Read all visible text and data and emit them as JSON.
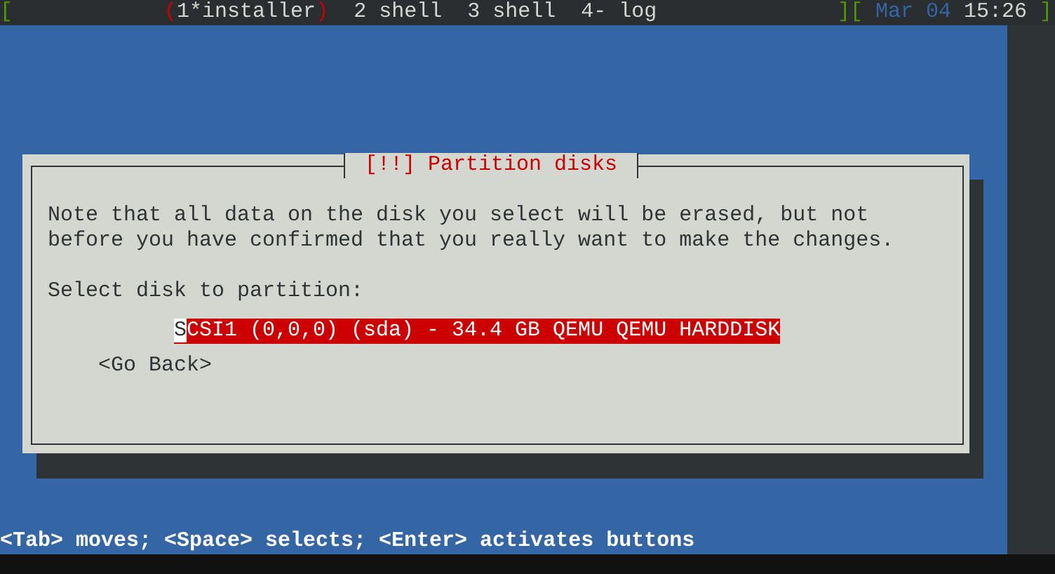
{
  "top_bar": {
    "open_bracket": "[",
    "selection_marks": [
      "(",
      ")"
    ],
    "divider": "][",
    "close_bracket": "]",
    "date": "Mar 04",
    "time": "15:26",
    "windows": [
      {
        "label": "1*installer",
        "selected": true
      },
      {
        "label": "2 shell",
        "selected": false
      },
      {
        "label": "3 shell",
        "selected": false
      },
      {
        "label": "4- log",
        "selected": false
      }
    ]
  },
  "dialog": {
    "title": "[!!] Partition disks",
    "message": "Note that all data on the disk you select will be erased, but not\nbefore you have confirmed that you really want to make the changes.",
    "prompt": "Select disk to partition:",
    "disks": [
      {
        "label": "SCSI1 (0,0,0) (sda) - 34.4 GB QEMU QEMU HARDDISK",
        "selected": true
      }
    ],
    "buttons": [
      "<Go Back>"
    ]
  },
  "help_line": "<Tab> moves; <Space> selects; <Enter> activates buttons"
}
